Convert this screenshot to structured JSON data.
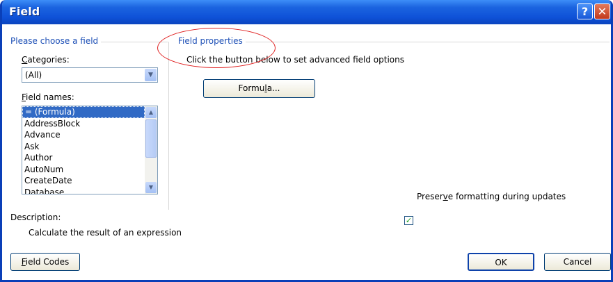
{
  "window": {
    "title": "Field",
    "help_label": "?",
    "close_label": "✕"
  },
  "left_group": {
    "legend": "Please choose a field",
    "categories_label": "Categories:",
    "categories_selected": "(All)",
    "field_names_label": "Field names:",
    "field_names": [
      "= (Formula)",
      "AddressBlock",
      "Advance",
      "Ask",
      "Author",
      "AutoNum",
      "CreateDate",
      "Database"
    ],
    "selected_index": 0
  },
  "right_group": {
    "legend": "Field properties",
    "instruction": "Click the button below to set advanced field options",
    "formula_button": "Formula...",
    "preserve_label": "Preserve formatting during updates",
    "preserve_checked": true
  },
  "description": {
    "label": "Description:",
    "text": "Calculate the result of an expression"
  },
  "footer": {
    "field_codes_button": "Field Codes",
    "ok_button": "OK",
    "cancel_button": "Cancel"
  },
  "colors": {
    "titlebar": "#0f52d8",
    "legend": "#1a4db5",
    "selection": "#316ac5",
    "annotation": "#e02020"
  },
  "icons": {
    "dropdown": "chevron-down-icon",
    "scroll_up": "scroll-up-icon",
    "scroll_down": "scroll-down-icon",
    "check": "check-icon"
  }
}
